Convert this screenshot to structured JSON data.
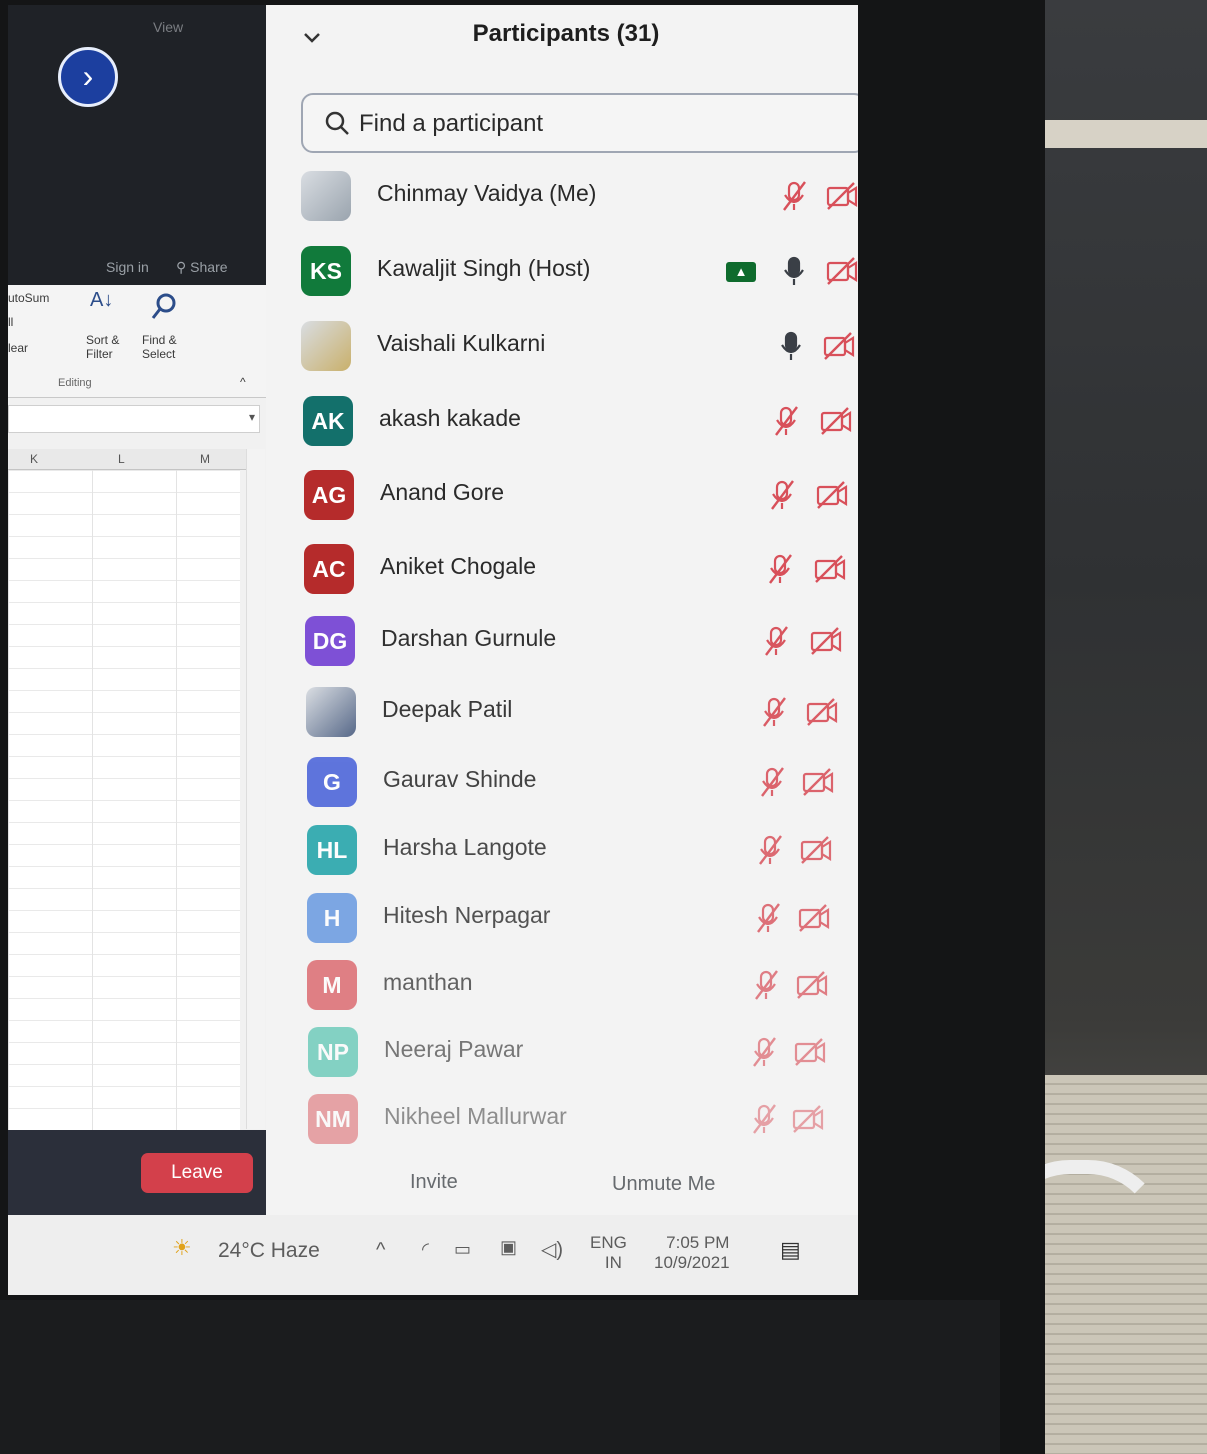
{
  "excel": {
    "view_label": "View",
    "next_icon": "chevron-right-icon",
    "sign_in": "Sign in",
    "share": "Share",
    "autosum": "utoSum",
    "fill": "ll",
    "clear": "lear",
    "sort_filter": "Sort &",
    "sort_filter_2": "Filter",
    "find_select": "Find &",
    "find_select_2": "Select",
    "editing_label": "Editing",
    "columns": [
      "K",
      "L",
      "M"
    ]
  },
  "meeting": {
    "leave_label": "Leave"
  },
  "participants": {
    "title": "Participants (31)",
    "search_placeholder": "Find a participant",
    "list": [
      {
        "name": "Chinmay Vaidya (Me)",
        "initials": "",
        "avatar": "photo",
        "color": "#9aa4ae",
        "mic": "muted",
        "video": "off",
        "sharing": false
      },
      {
        "name": "Kawaljit Singh (Host)",
        "initials": "KS",
        "avatar": "initials",
        "color": "#117a3b",
        "mic": "on",
        "video": "off",
        "sharing": true
      },
      {
        "name": "Vaishali Kulkarni",
        "initials": "",
        "avatar": "photo",
        "color": "#c9b06b",
        "mic": "on",
        "video": "off",
        "sharing": false
      },
      {
        "name": "akash kakade",
        "initials": "AK",
        "avatar": "initials",
        "color": "#13706b",
        "mic": "muted",
        "video": "off",
        "sharing": false
      },
      {
        "name": "Anand Gore",
        "initials": "AG",
        "avatar": "initials",
        "color": "#b52b2b",
        "mic": "muted",
        "video": "off",
        "sharing": false
      },
      {
        "name": "Aniket Chogale",
        "initials": "AC",
        "avatar": "initials",
        "color": "#b52b2b",
        "mic": "muted",
        "video": "off",
        "sharing": false
      },
      {
        "name": "Darshan Gurnule",
        "initials": "DG",
        "avatar": "initials",
        "color": "#7b4bd6",
        "mic": "muted",
        "video": "off",
        "sharing": false
      },
      {
        "name": "Deepak Patil",
        "initials": "",
        "avatar": "photo",
        "color": "#4a5d80",
        "mic": "muted",
        "video": "off",
        "sharing": false
      },
      {
        "name": "Gaurav Shinde",
        "initials": "G",
        "avatar": "initials",
        "color": "#4a63d9",
        "mic": "muted",
        "video": "off",
        "sharing": false
      },
      {
        "name": "Harsha Langote",
        "initials": "HL",
        "avatar": "initials",
        "color": "#19a0a6",
        "mic": "muted",
        "video": "off",
        "sharing": false
      },
      {
        "name": "Hitesh Nerpagar",
        "initials": "H",
        "avatar": "initials",
        "color": "#5f93e0",
        "mic": "muted",
        "video": "off",
        "sharing": false
      },
      {
        "name": "manthan",
        "initials": "M",
        "avatar": "initials",
        "color": "#d8535a",
        "mic": "muted",
        "video": "off",
        "sharing": false
      },
      {
        "name": "Neeraj Pawar",
        "initials": "NP",
        "avatar": "initials",
        "color": "#3fbda7",
        "mic": "muted",
        "video": "off",
        "sharing": false
      },
      {
        "name": "Nikheel Mallurwar",
        "initials": "NM",
        "avatar": "initials",
        "color": "#d8535a",
        "mic": "muted",
        "video": "off",
        "sharing": false
      }
    ],
    "invite_label": "Invite",
    "unmute_label": "Unmute Me"
  },
  "taskbar": {
    "weather": "24°C  Haze",
    "language_1": "ENG",
    "language_2": "IN",
    "time": "7:05 PM",
    "date": "10/9/2021"
  },
  "colors": {
    "muted_icon": "#d8505a",
    "active_mic": "#3a3f46",
    "accent": "#4b6ba6"
  }
}
